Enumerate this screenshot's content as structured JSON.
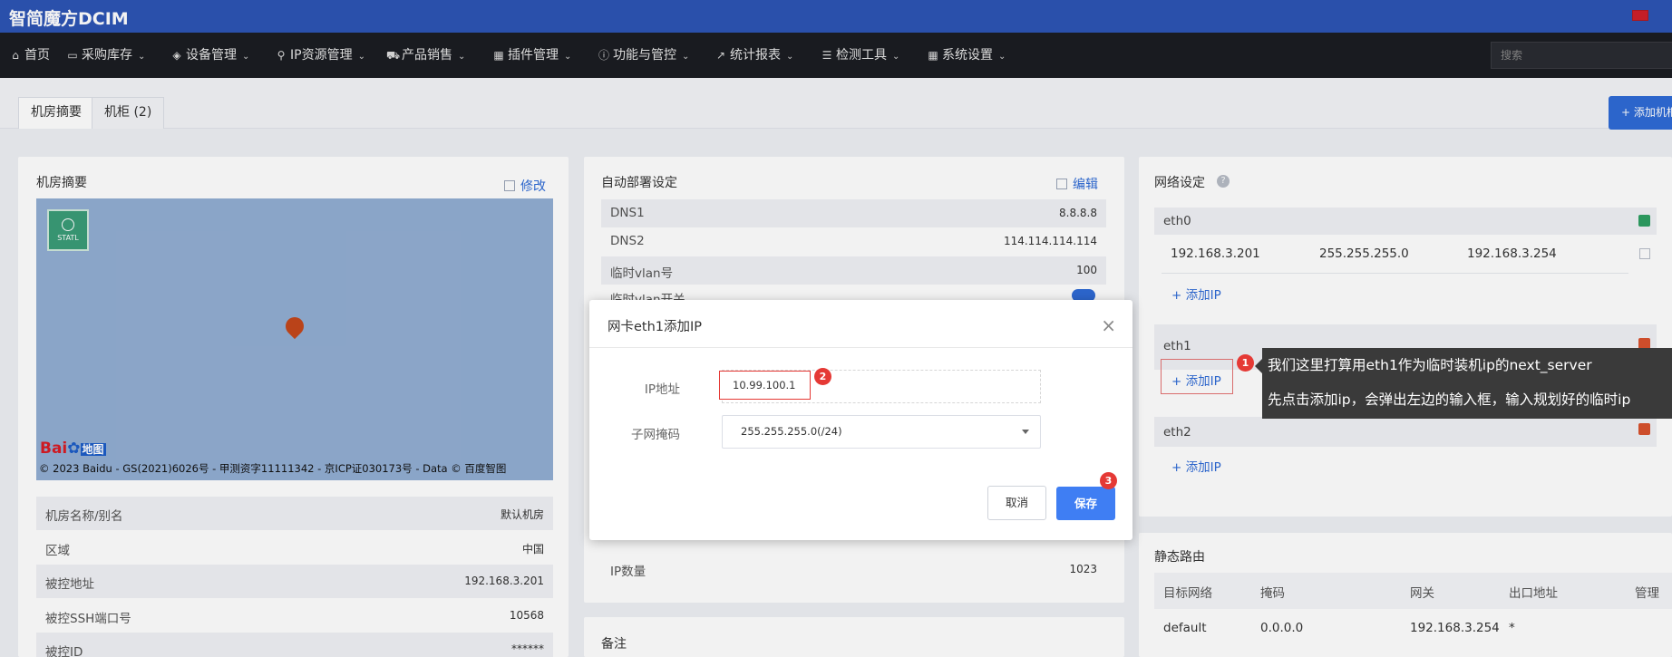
{
  "brand": {
    "title": "智简魔方DCIM"
  },
  "nav": {
    "items": [
      {
        "icon": "home-icon",
        "label": "首页",
        "has_menu": false
      },
      {
        "icon": "cart-icon",
        "label": "采购库存",
        "has_menu": true
      },
      {
        "icon": "cube-icon",
        "label": "设备管理",
        "has_menu": true
      },
      {
        "icon": "map-marker-icon",
        "label": "IP资源管理",
        "has_menu": true
      },
      {
        "icon": "shopping-cart-icon",
        "label": "产品销售",
        "has_menu": true
      },
      {
        "icon": "grid-icon",
        "label": "插件管理",
        "has_menu": true
      },
      {
        "icon": "info-icon",
        "label": "功能与管控",
        "has_menu": true
      },
      {
        "icon": "chart-line-icon",
        "label": "统计报表",
        "has_menu": true
      },
      {
        "icon": "list-icon",
        "label": "检测工具",
        "has_menu": true
      },
      {
        "icon": "th-large-icon",
        "label": "系统设置",
        "has_menu": true
      }
    ],
    "search_placeholder": "搜索"
  },
  "tabs": [
    {
      "label": "机房摘要",
      "active": true
    },
    {
      "label": "机柜 (2)",
      "active": false
    }
  ],
  "add_room_button": "+ 添加机柜",
  "summary_panel": {
    "title": "机房摘要",
    "edit_label": "修改",
    "map": {
      "stamp_text": "STATL",
      "logo_text": "Bai",
      "logo_suffix": "地图",
      "copyright": "© 2023 Baidu - GS(2021)6026号 - 甲测资字11111342 - 京ICP证030173号 - Data © 百度智图"
    },
    "rows": [
      {
        "key": "机房名称/别名",
        "value": "默认机房"
      },
      {
        "key": "区域",
        "value": "中国"
      },
      {
        "key": "被控地址",
        "value": "192.168.3.201"
      },
      {
        "key": "被控SSH端口号",
        "value": "10568"
      },
      {
        "key": "被控ID",
        "value": "******"
      }
    ]
  },
  "deploy_panel": {
    "title": "自动部署设定",
    "edit_label": "编辑",
    "rows": [
      {
        "key": "DNS1",
        "value": "8.8.8.8"
      },
      {
        "key": "DNS2",
        "value": "114.114.114.114"
      },
      {
        "key": "临时vlan号",
        "value": "100"
      },
      {
        "key": "临时vlan开关",
        "value": ""
      }
    ],
    "ip_count_label": "IP数量",
    "ip_count_value": "1023"
  },
  "notes_panel": {
    "title": "备注"
  },
  "network_panel": {
    "title": "网络设定",
    "eth0": {
      "name": "eth0",
      "status_color": "#2e9f62",
      "ip": "192.168.3.201",
      "mask": "255.255.255.0",
      "gateway": "192.168.3.254",
      "add_ip": "+ 添加IP"
    },
    "eth1": {
      "name": "eth1",
      "status_color": "#d9522e",
      "add_ip": "+ 添加IP"
    },
    "eth2": {
      "name": "eth2",
      "status_color": "#d9522e",
      "add_ip": "+ 添加IP"
    }
  },
  "route_panel": {
    "title": "静态路由",
    "headers": [
      "目标网络",
      "掩码",
      "网关",
      "出口地址",
      "管理"
    ],
    "rows": [
      {
        "target": "default",
        "mask": "0.0.0.0",
        "gateway": "192.168.3.254",
        "exit": "*"
      }
    ]
  },
  "modal": {
    "title": "网卡eth1添加IP",
    "ip_label": "IP地址",
    "ip_value": "10.99.100.1",
    "mask_label": "子网掩码",
    "mask_value": "255.255.255.0(/24)",
    "cancel_label": "取消",
    "save_label": "保存"
  },
  "badges": {
    "one": "1",
    "two": "2",
    "three": "3"
  },
  "tooltip": {
    "line1": "我们这里打算用eth1作为临时装机ip的next_server",
    "line2": "先点击添加ip，会弹出左边的输入框，输入规划好的临时ip"
  }
}
